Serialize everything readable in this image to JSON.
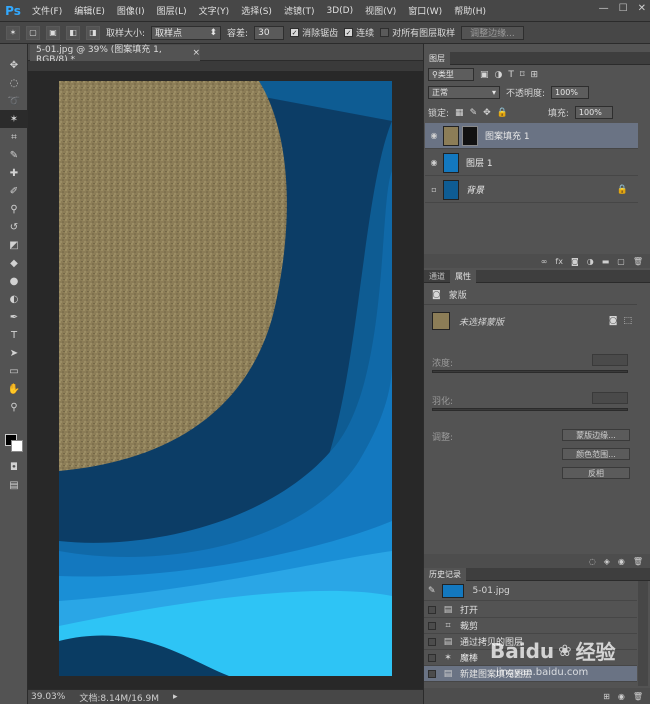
{
  "menubar": {
    "logo": "Ps",
    "items": [
      "文件(F)",
      "编辑(E)",
      "图像(I)",
      "图层(L)",
      "文字(Y)",
      "选择(S)",
      "滤镜(T)",
      "3D(D)",
      "视图(V)",
      "窗口(W)",
      "帮助(H)"
    ],
    "win_controls": [
      "—",
      "☐",
      "✕"
    ]
  },
  "options": {
    "sample_size_label": "取样大小:",
    "sample_size_value": "取样点",
    "tolerance_label": "容差:",
    "tolerance_value": "30",
    "antialias_label": "消除锯齿",
    "contiguous_label": "连续",
    "sample_all_label": "对所有图层取样",
    "refine_edge_label": "调整边缘..."
  },
  "document": {
    "tab_title": "5-01.jpg @ 39% (图案填充 1, RGB/8) *",
    "tab_close": "×",
    "zoom": "39.03%",
    "doc_info": "文档:8.14M/16.9M"
  },
  "layers_panel": {
    "tab": "图层",
    "filter_kind": "类型",
    "blend_mode": "正常",
    "opacity_label": "不透明度:",
    "opacity_value": "100%",
    "lock_label": "锁定:",
    "fill_label": "填充:",
    "fill_value": "100%",
    "layers": [
      {
        "name": "图案填充 1",
        "selected": true,
        "visible": true
      },
      {
        "name": "图层 1",
        "selected": false,
        "visible": true
      },
      {
        "name": "背景",
        "selected": false,
        "visible": false,
        "locked": true
      }
    ],
    "footer_icons": [
      "link-icon",
      "fx-icon",
      "mask-icon",
      "adjustment-icon",
      "folder-icon",
      "new-layer-icon",
      "trash-icon"
    ]
  },
  "properties_panel": {
    "tabs": [
      "通道",
      "属性"
    ],
    "active_tab": "属性",
    "header": "蒙版",
    "mask_label": "未选择蒙版",
    "density_label": "浓度:",
    "feather_label": "羽化:",
    "adjust_label": "调整:",
    "mask_edge_button": "蒙版边缘...",
    "color_range_button": "颜色范围...",
    "invert_button": "反相"
  },
  "history_panel": {
    "tab": "历史记录",
    "snapshot": "5-01.jpg",
    "items": [
      {
        "label": "打开",
        "icon": "document-icon"
      },
      {
        "label": "裁剪",
        "icon": "crop-icon"
      },
      {
        "label": "通过拷贝的图层",
        "icon": "document-icon"
      },
      {
        "label": "魔棒",
        "icon": "magic-wand-icon"
      },
      {
        "label": "新建图案填充图层",
        "icon": "document-icon"
      }
    ]
  },
  "watermark": {
    "brand": "Baidu",
    "brand_cn": "经验",
    "url": "jingyan.baidu.com"
  },
  "colors": {
    "accent_blue": "#32a9ff",
    "selection": "#6a7384",
    "sand": "#8c7d57"
  }
}
